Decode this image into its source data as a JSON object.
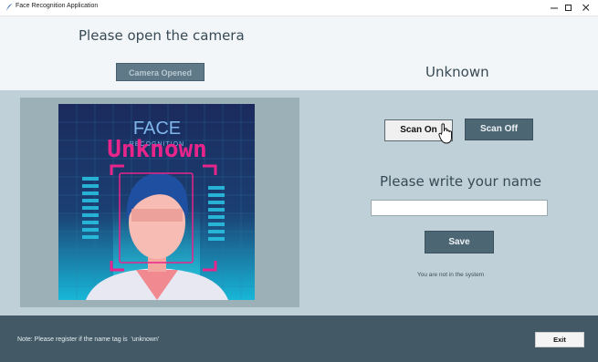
{
  "window": {
    "title": "Face Recognition Application",
    "controls": [
      "minimize-icon",
      "maximize-icon",
      "close-icon"
    ]
  },
  "camera": {
    "prompt": "Please open the camera",
    "button_label": "Camera Opened"
  },
  "recognition": {
    "status_title": "Unknown",
    "overlay_text": "Unknown",
    "image_heading": "FACE",
    "image_subheading": "RECOGNITION"
  },
  "scan": {
    "on_label": "Scan On",
    "off_label": "Scan Off"
  },
  "registration": {
    "name_prompt": "Please write your name",
    "name_value": "",
    "save_label": "Save",
    "system_status": "You are not in the system"
  },
  "footer": {
    "note": "Note: Please register if the name tag is  'unknown'",
    "exit_label": "Exit"
  },
  "colors": {
    "top_panel": "#f2f6f8",
    "middle_panel": "#c0d0d8",
    "bottom_panel": "#435a66",
    "button_dark": "#4d6674",
    "accent_pink": "#e8258a"
  }
}
